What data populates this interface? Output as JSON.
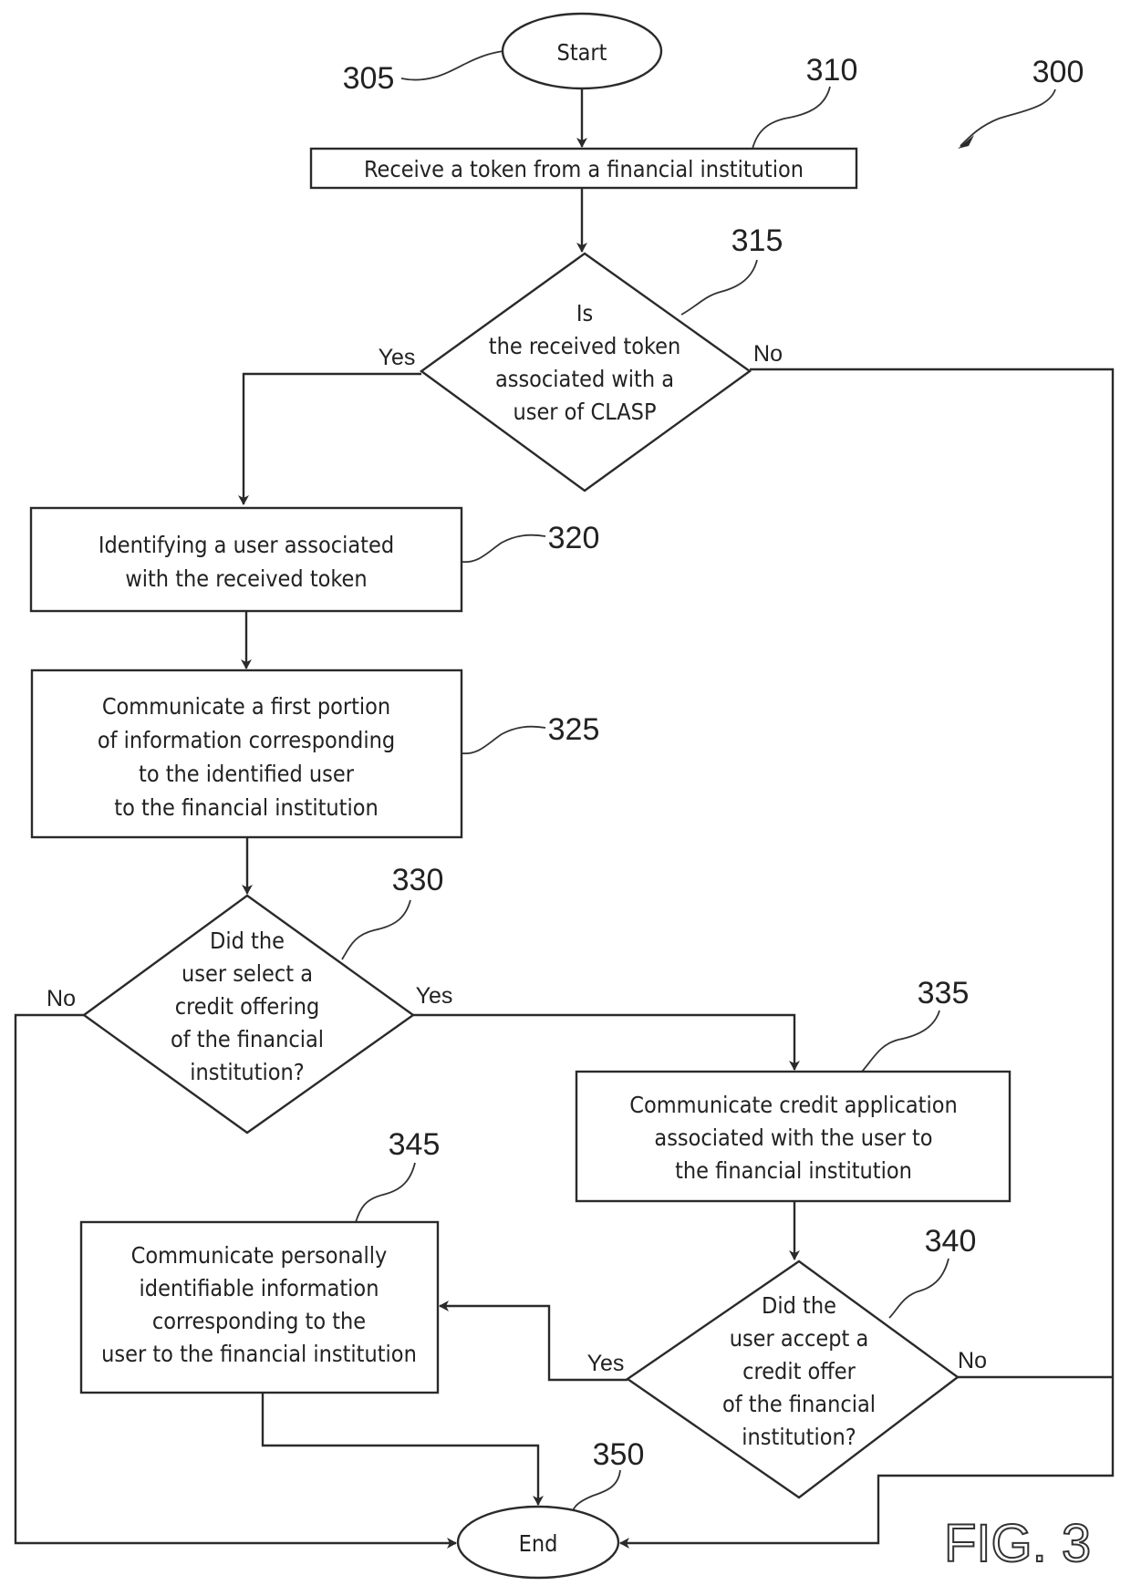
{
  "figure": {
    "title": "FIG. 3",
    "reference": "300"
  },
  "nodes": {
    "start": {
      "ref": "305",
      "type": "terminal",
      "lines": [
        "Start"
      ]
    },
    "receive_token": {
      "ref": "310",
      "type": "process",
      "lines": [
        "Receive a token from a financial institution"
      ]
    },
    "token_associated": {
      "ref": "315",
      "type": "decision",
      "lines": [
        "Is",
        "the received token",
        "associated with a",
        "user of CLASP"
      ],
      "yes_label": "Yes",
      "no_label": "No"
    },
    "identify_user": {
      "ref": "320",
      "type": "process",
      "lines": [
        "Identifying a user associated",
        "with the received token"
      ]
    },
    "communicate_first_portion": {
      "ref": "325",
      "type": "process",
      "lines": [
        "Communicate a first portion",
        "of information corresponding",
        "to the identified user",
        "to the financial institution"
      ]
    },
    "select_credit_offering": {
      "ref": "330",
      "type": "decision",
      "lines": [
        "Did the",
        "user select a",
        "credit offering",
        "of the financial",
        "institution?"
      ],
      "yes_label": "Yes",
      "no_label": "No"
    },
    "communicate_credit_application": {
      "ref": "335",
      "type": "process",
      "lines": [
        "Communicate credit application",
        "associated with the user to",
        "the financial institution"
      ]
    },
    "accept_credit_offer": {
      "ref": "340",
      "type": "decision",
      "lines": [
        "Did the",
        "user accept a",
        "credit offer",
        "of the financial",
        "institution?"
      ],
      "yes_label": "Yes",
      "no_label": "No"
    },
    "communicate_pii": {
      "ref": "345",
      "type": "process",
      "lines": [
        "Communicate personally",
        "identifiable information",
        "corresponding to the",
        "user to the financial institution"
      ]
    },
    "end": {
      "ref": "350",
      "type": "terminal",
      "lines": [
        "End"
      ]
    }
  },
  "edges": [
    {
      "from": "start",
      "to": "receive_token",
      "label": ""
    },
    {
      "from": "receive_token",
      "to": "token_associated",
      "label": ""
    },
    {
      "from": "token_associated",
      "to": "identify_user",
      "label": "Yes"
    },
    {
      "from": "token_associated",
      "to": "end",
      "label": "No"
    },
    {
      "from": "identify_user",
      "to": "communicate_first_portion",
      "label": ""
    },
    {
      "from": "communicate_first_portion",
      "to": "select_credit_offering",
      "label": ""
    },
    {
      "from": "select_credit_offering",
      "to": "communicate_credit_application",
      "label": "Yes"
    },
    {
      "from": "select_credit_offering",
      "to": "end",
      "label": "No"
    },
    {
      "from": "communicate_credit_application",
      "to": "accept_credit_offer",
      "label": ""
    },
    {
      "from": "accept_credit_offer",
      "to": "communicate_pii",
      "label": "Yes"
    },
    {
      "from": "accept_credit_offer",
      "to": "end",
      "label": "No"
    },
    {
      "from": "communicate_pii",
      "to": "end",
      "label": ""
    }
  ]
}
